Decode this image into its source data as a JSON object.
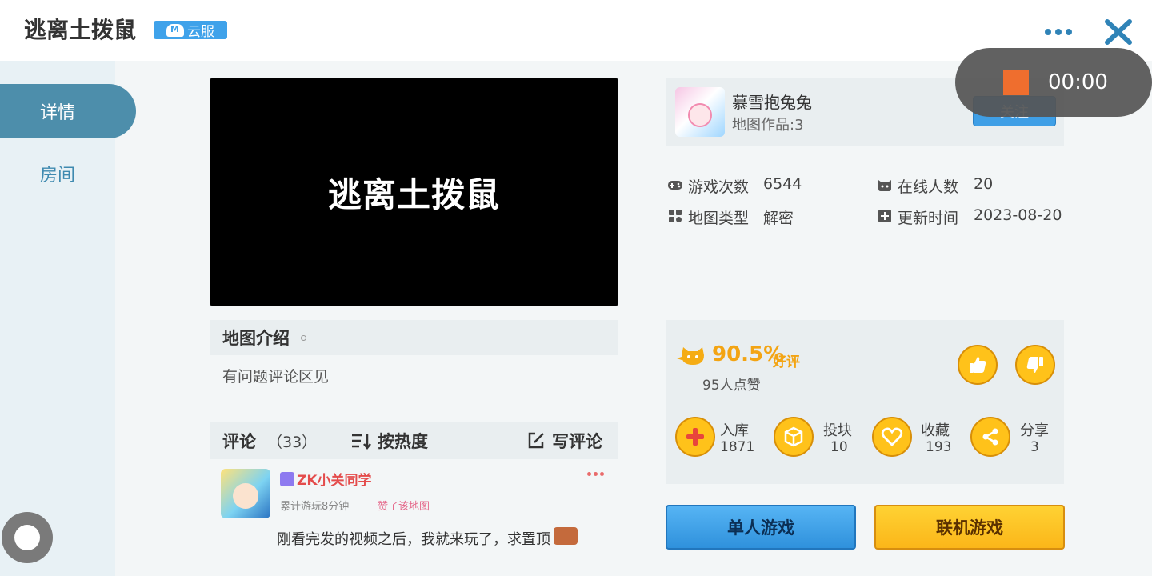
{
  "header": {
    "title": "逃离土拨鼠",
    "cloud_badge": "云服"
  },
  "sidebar": {
    "items": [
      {
        "label": "详情",
        "active": true
      },
      {
        "label": "房间",
        "active": false
      }
    ]
  },
  "preview": {
    "title": "逃离土拨鼠"
  },
  "intro": {
    "title": "地图介绍",
    "text": "有问题评论区见"
  },
  "comments": {
    "label": "评论",
    "count": "（33）",
    "sort_label": "按热度",
    "write_label": "写评论",
    "items": [
      {
        "user": "ZK小关同学",
        "play_time": "累计游玩8分钟",
        "liked": "赞了该地图",
        "text": "刚看完发的视频之后，我就来玩了，求置顶"
      }
    ]
  },
  "author": {
    "name": "慕雪抱兔兔",
    "works": "地图作品:3",
    "follow_label": "关注"
  },
  "recorder": {
    "time": "00:00"
  },
  "stats": {
    "plays_label": "游戏次数",
    "plays_value": "6544",
    "online_label": "在线人数",
    "online_value": "20",
    "type_label": "地图类型",
    "type_value": "解密",
    "updated_label": "更新时间",
    "updated_value": "2023-08-20"
  },
  "rating": {
    "percent": "90.5%",
    "good_label": "好评",
    "like_count": "95人点赞"
  },
  "actions": [
    {
      "label": "入库",
      "count": "1871",
      "icon": "plus-icon"
    },
    {
      "label": "投块",
      "count": "10",
      "icon": "block-icon"
    },
    {
      "label": "收藏",
      "count": "193",
      "icon": "heart-icon"
    },
    {
      "label": "分享",
      "count": "3",
      "icon": "share-icon"
    }
  ],
  "buttons": {
    "single": "单人游戏",
    "multi": "联机游戏"
  },
  "colors": {
    "accent_blue": "#3fa2ea",
    "accent_yellow": "#ffc21a",
    "sidebar_active": "#4d8eab"
  }
}
